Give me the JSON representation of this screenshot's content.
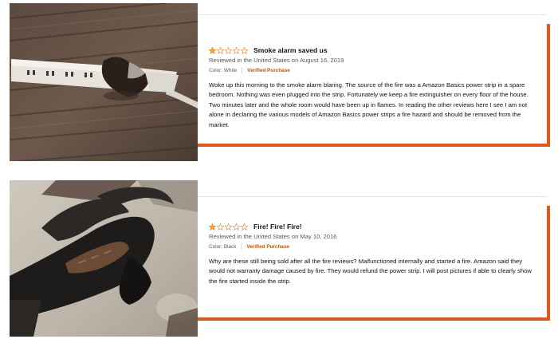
{
  "colors": {
    "accent_border": "#e0571b",
    "star_filled": "#ffa41c",
    "verified_text": "#c45500",
    "muted_text": "#565959"
  },
  "reviews": [
    {
      "rating": 1,
      "max_rating": 5,
      "title": "Smoke alarm saved us",
      "meta": "Reviewed in the United States on August 16, 2019",
      "color_attr": "Color: White",
      "verified": "Verified Purchase",
      "body": "Woke up this morning to the smoke alarm blaring. The source of the fire was a Amazon Basics power strip in a spare bedroom. Nothing was even plugged into the strip. Fortunately we keep a fire extinguisher on every floor of the house. Two minutes later and the whole room would have been up in flames. In reading the other reviews here I see I am not alone in declaring the various models of Amazon Basics power strips a fire hazard and should be removed from the market.",
      "photo_icon": "burned-power-strip-photo"
    },
    {
      "rating": 1,
      "max_rating": 5,
      "title": "Fire! Fire! Fire!",
      "meta": "Reviewed in the United States on May 10, 2016",
      "color_attr": "Color: Black",
      "verified": "Verified Purchase",
      "body": "Why are these still being sold after all the fire reviews? Malfunctioned internally and started a fire. Amazon said they would not warranty damage caused by fire. They would refund the power strip. I will post pictures if able to clearly show the fire started inside the strip.",
      "photo_icon": "melted-power-strip-photo"
    }
  ]
}
